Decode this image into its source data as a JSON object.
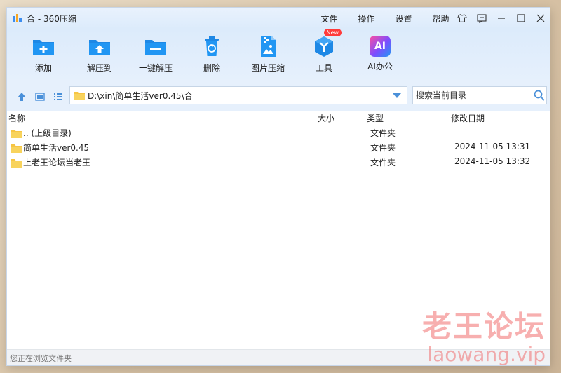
{
  "window": {
    "title": "合 - 360压缩"
  },
  "menu": {
    "items": [
      "文件",
      "操作",
      "设置",
      "帮助"
    ]
  },
  "toolbar": {
    "items": [
      {
        "label": "添加",
        "icon": "add-folder-icon"
      },
      {
        "label": "解压到",
        "icon": "extract-to-icon"
      },
      {
        "label": "一键解压",
        "icon": "one-click-extract-icon"
      },
      {
        "label": "删除",
        "icon": "trash-icon"
      },
      {
        "label": "图片压缩",
        "icon": "image-compress-icon"
      },
      {
        "label": "工具",
        "icon": "tools-cube-icon",
        "badge": "New"
      },
      {
        "label": "AI办公",
        "icon": "ai-office-icon",
        "icon_text": "AI"
      }
    ]
  },
  "address": {
    "path": "D:\\xin\\简单生活ver0.45\\合"
  },
  "search": {
    "placeholder": "搜索当前目录"
  },
  "columns": {
    "name": "名称",
    "size": "大小",
    "type": "类型",
    "modified": "修改日期"
  },
  "files": [
    {
      "name": ".. (上级目录)",
      "type": "文件夹",
      "date": ""
    },
    {
      "name": "简单生活ver0.45",
      "type": "文件夹",
      "date": "2024-11-05 13:31"
    },
    {
      "name": "上老王论坛当老王",
      "type": "文件夹",
      "date": "2024-11-05 13:32"
    }
  ],
  "status": {
    "text": "您正在浏览文件夹"
  },
  "watermark": {
    "line1": "老王论坛",
    "line2": "laowang.vip"
  },
  "colors": {
    "accent": "#1e88e5",
    "folder": "#f6c544",
    "titlebar": "#dcebfb",
    "new_badge": "#ff3b3b"
  }
}
